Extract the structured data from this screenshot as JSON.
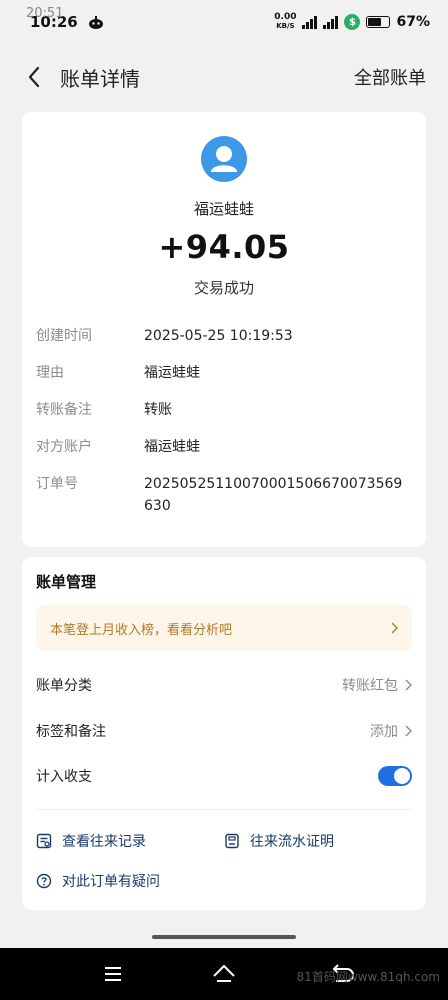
{
  "status_bar": {
    "time": "10:26",
    "ghost_time": "20:51",
    "net_speed_value": "0.00",
    "net_speed_unit": "KB/S",
    "battery": "67%"
  },
  "nav": {
    "title": "账单详情",
    "right_link": "全部账单"
  },
  "transaction": {
    "payer": "福运蛙蛙",
    "amount": "+94.05",
    "status": "交易成功",
    "details": [
      {
        "key": "创建时间",
        "value": "2025-05-25 10:19:53"
      },
      {
        "key": "理由",
        "value": "福运蛙蛙"
      },
      {
        "key": "转账备注",
        "value": "转账"
      },
      {
        "key": "对方账户",
        "value": "福运蛙蛙"
      },
      {
        "key": "订单号",
        "value": "20250525110070001506670073569630"
      }
    ]
  },
  "management": {
    "title": "账单管理",
    "banner": "本笔登上月收入榜，看看分析吧",
    "category_label": "账单分类",
    "category_value": "转账红包",
    "tags_label": "标签和备注",
    "tags_value": "添加",
    "count_label": "计入收支",
    "count_enabled": true,
    "link_history": "查看往来记录",
    "link_proof": "往来流水证明",
    "link_question": "对此订单有疑问"
  },
  "watermark": "81首码网www.81qh.com",
  "colors": {
    "accent_blue": "#1f6fe0",
    "avatar_blue": "#3d98e8",
    "banner_bg": "#fdf6e8",
    "banner_text": "#b27a28",
    "link_text": "#1a3a6b"
  },
  "icons": [
    "back-arrow-icon",
    "user-avatar-icon",
    "chevron-right-icon",
    "history-record-icon",
    "document-proof-icon",
    "question-circle-icon",
    "menu-icon",
    "home-icon",
    "back-key-icon"
  ]
}
